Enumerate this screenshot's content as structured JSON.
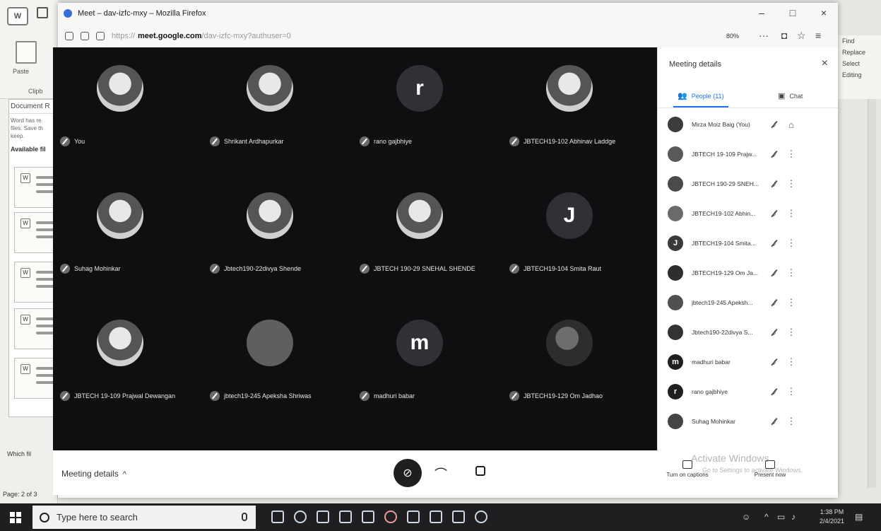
{
  "word": {
    "logo_text": "W",
    "ribbon_label_paste": "Paste",
    "ribbon_label_clipboard": "Clipb",
    "doc_recovery_header": "Document R",
    "doc_recovery_text_1": "Word has re",
    "doc_recovery_text_2": "files. Save th",
    "doc_recovery_text_3": "keep.",
    "available_label": "Available fil",
    "which_label": "Which fil",
    "page_indicator": "Page: 2 of 3",
    "right_find": "Find",
    "right_replace": "Replace",
    "right_select": "Select",
    "right_editing": "Editing"
  },
  "firefox": {
    "title": "Meet – dav-izfc-mxy – Mozilla Firefox",
    "url_prefix": "https://",
    "url_host": "meet.google.com",
    "url_path": "/dav-izfc-mxy?authuser=0",
    "zoom": "80%",
    "minimize": "–",
    "maximize": "□",
    "close": "×",
    "more": "···"
  },
  "meet": {
    "tiles": [
      {
        "name": "You",
        "avatar": "photo"
      },
      {
        "name": "Shrikant Ardhapurkar",
        "avatar": "photo"
      },
      {
        "name": "rano gajbhiye",
        "avatar": "letter",
        "letter": "r"
      },
      {
        "name": "JBTECH19-102 Abhinav Laddge",
        "avatar": "photo"
      },
      {
        "name": "Suhag Mohinkar",
        "avatar": "photo"
      },
      {
        "name": "Jbtech190-22divya Shende",
        "avatar": "photo"
      },
      {
        "name": "JBTECH 190-29 SNEHAL SHENDE",
        "avatar": "photo"
      },
      {
        "name": "JBTECH19-104 Smita Raut",
        "avatar": "letter",
        "letter": "J"
      },
      {
        "name": "JBTECH 19-109 Prajwal Dewangan",
        "avatar": "photo"
      },
      {
        "name": "jbtech19-245 Apeksha Shriwas",
        "avatar": "grey"
      },
      {
        "name": "madhuri babar",
        "avatar": "letter",
        "letter": "m"
      },
      {
        "name": "JBTECH19-129 Om Jadhao",
        "avatar": "dark"
      }
    ],
    "panel": {
      "title": "Meeting details",
      "tab_people": "People (11)",
      "tab_chat": "Chat",
      "people": [
        {
          "name": "Mirza Moiz Baig (You)",
          "initial": "",
          "color": "#3b3b3b"
        },
        {
          "name": "JBTECH 19-109 Prajw...",
          "initial": "",
          "color": "#595959"
        },
        {
          "name": "JBTECH 190-29 SNEH...",
          "initial": "",
          "color": "#4a4a4a"
        },
        {
          "name": "JBTECH19-102 Abhin...",
          "initial": "",
          "color": "#6a6a6a"
        },
        {
          "name": "JBTECH19-104 Smita...",
          "initial": "J",
          "color": "#3a3a3a"
        },
        {
          "name": "JBTECH19-129 Om Ja...",
          "initial": "",
          "color": "#2e2e2e"
        },
        {
          "name": "jbtech19-245 Apeksh...",
          "initial": "",
          "color": "#505050"
        },
        {
          "name": "Jbtech190-22divya S...",
          "initial": "",
          "color": "#333"
        },
        {
          "name": "madhuri babar",
          "initial": "m",
          "color": "#1f1f1f"
        },
        {
          "name": "rano gajbhiye",
          "initial": "r",
          "color": "#1f1f1f"
        },
        {
          "name": "Suhag Mohinkar",
          "initial": "",
          "color": "#444"
        }
      ]
    },
    "bottom": {
      "meeting_details": "Meeting details",
      "captions": "Turn on captions",
      "present": "Present now"
    },
    "watermark_1": "Activate Windows",
    "watermark_2": "Go to Settings to activate Windows."
  },
  "taskbar": {
    "search_placeholder": "Type here to search",
    "time": "1:38 PM",
    "date": "2/4/2021"
  }
}
